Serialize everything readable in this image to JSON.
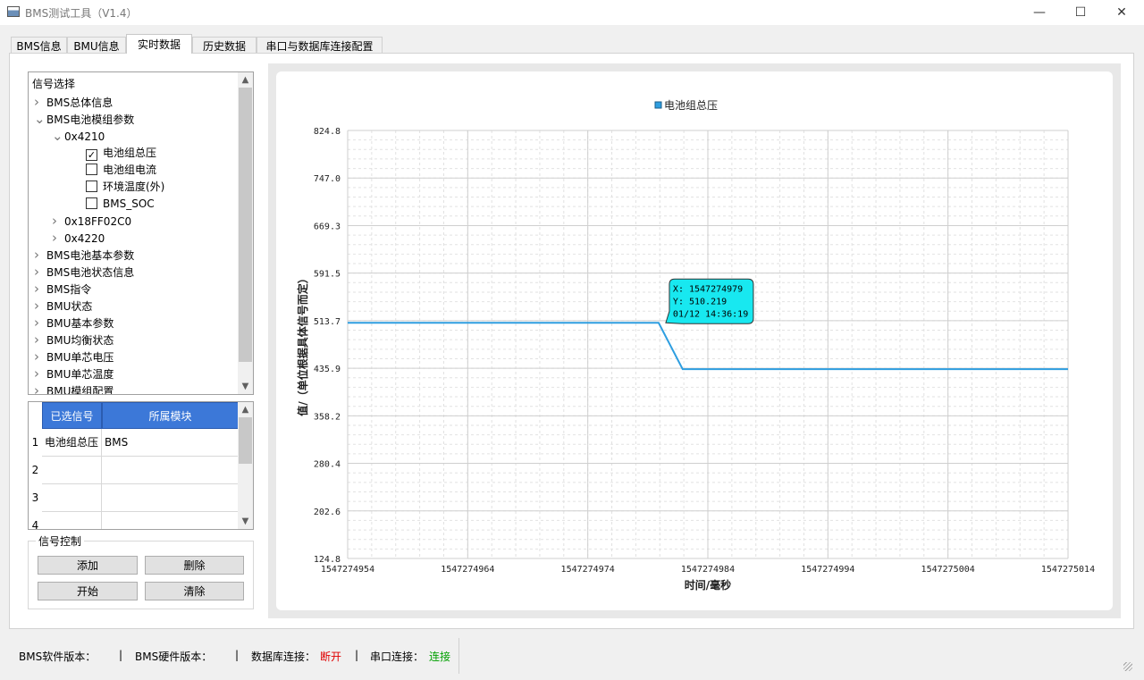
{
  "window": {
    "title": "BMS测试工具（V1.4）",
    "minimize_glyph": "—",
    "maximize_glyph": "☐",
    "close_glyph": "✕"
  },
  "tabs": [
    {
      "label": "BMS信息",
      "active": false
    },
    {
      "label": "BMU信息",
      "active": false
    },
    {
      "label": "实时数据",
      "active": true
    },
    {
      "label": "历史数据",
      "active": false
    },
    {
      "label": "串口与数据库连接配置",
      "active": false
    }
  ],
  "signal_tree": {
    "header": "信号选择",
    "items": [
      {
        "label": "BMS总体信息",
        "level": 0,
        "expander": "collapsed",
        "checkbox": false,
        "checked": false
      },
      {
        "label": "BMS电池模组参数",
        "level": 0,
        "expander": "expanded",
        "checkbox": false,
        "checked": false
      },
      {
        "label": "0x4210",
        "level": 1,
        "expander": "expanded",
        "checkbox": false,
        "checked": false
      },
      {
        "label": "电池组总压",
        "level": 2,
        "expander": "none",
        "checkbox": true,
        "checked": true
      },
      {
        "label": "电池组电流",
        "level": 2,
        "expander": "none",
        "checkbox": true,
        "checked": false
      },
      {
        "label": "环境温度(外)",
        "level": 2,
        "expander": "none",
        "checkbox": true,
        "checked": false
      },
      {
        "label": "BMS_SOC",
        "level": 2,
        "expander": "none",
        "checkbox": true,
        "checked": false
      },
      {
        "label": "0x18FF02C0",
        "level": 1,
        "expander": "collapsed",
        "checkbox": false,
        "checked": false
      },
      {
        "label": "0x4220",
        "level": 1,
        "expander": "collapsed",
        "checkbox": false,
        "checked": false
      },
      {
        "label": "BMS电池基本参数",
        "level": 0,
        "expander": "collapsed",
        "checkbox": false,
        "checked": false
      },
      {
        "label": "BMS电池状态信息",
        "level": 0,
        "expander": "collapsed",
        "checkbox": false,
        "checked": false
      },
      {
        "label": "BMS指令",
        "level": 0,
        "expander": "collapsed",
        "checkbox": false,
        "checked": false
      },
      {
        "label": "BMU状态",
        "level": 0,
        "expander": "collapsed",
        "checkbox": false,
        "checked": false
      },
      {
        "label": "BMU基本参数",
        "level": 0,
        "expander": "collapsed",
        "checkbox": false,
        "checked": false
      },
      {
        "label": "BMU均衡状态",
        "level": 0,
        "expander": "collapsed",
        "checkbox": false,
        "checked": false
      },
      {
        "label": "BMU单芯电压",
        "level": 0,
        "expander": "collapsed",
        "checkbox": false,
        "checked": false
      },
      {
        "label": "BMU单芯温度",
        "level": 0,
        "expander": "collapsed",
        "checkbox": false,
        "checked": false
      },
      {
        "label": "BMU模组配置",
        "level": 0,
        "expander": "collapsed",
        "checkbox": false,
        "checked": false
      }
    ]
  },
  "selected_table": {
    "columns": [
      "已选信号",
      "所属模块"
    ],
    "rows": [
      {
        "num": "1",
        "signal": "电池组总压",
        "module": "BMS"
      },
      {
        "num": "2",
        "signal": "",
        "module": ""
      },
      {
        "num": "3",
        "signal": "",
        "module": ""
      },
      {
        "num": "4",
        "signal": "",
        "module": ""
      }
    ]
  },
  "signal_control": {
    "title": "信号控制",
    "add": "添加",
    "delete": "删除",
    "start": "开始",
    "clear": "清除"
  },
  "chart_data": {
    "type": "line",
    "legend": [
      "电池组总压"
    ],
    "legend_position": "top",
    "xlabel": "时间/毫秒",
    "ylabel": "值/（单位根据具体信号而定）",
    "xlim": [
      1547274954,
      1547275014
    ],
    "ylim": [
      124.8,
      824.8
    ],
    "x_ticks": [
      "1547274954",
      "1547274964",
      "1547274974",
      "1547274984",
      "1547274994",
      "1547275004",
      "1547275014"
    ],
    "y_ticks": [
      "824.8",
      "747.0",
      "669.3",
      "591.5",
      "513.7",
      "435.9",
      "358.2",
      "280.4",
      "202.6",
      "124.8"
    ],
    "grid": true,
    "color": "#2e9ee0",
    "series": [
      {
        "name": "电池组总压",
        "x": [
          1547274954,
          1547274979.9,
          1547274981.9,
          1547275014
        ],
        "y": [
          510.219,
          510.219,
          434.5,
          434.5
        ]
      }
    ],
    "tooltip": {
      "x_value": 1547274979.9,
      "y_value": 510.219,
      "lines": [
        "X: 1547274979",
        "Y: 510.219",
        "01/12 14:36:19"
      ]
    }
  },
  "status": {
    "sw_label": "BMS软件版本：",
    "sep1": "|",
    "hw_label": "BMS硬件版本：",
    "sep2": "|",
    "db_label": "数据库连接：",
    "db_value": "断开",
    "db_color": "#e00000",
    "sep3": "|",
    "serial_label": "串口连接：",
    "serial_value": "连接",
    "serial_color": "#00a000"
  }
}
